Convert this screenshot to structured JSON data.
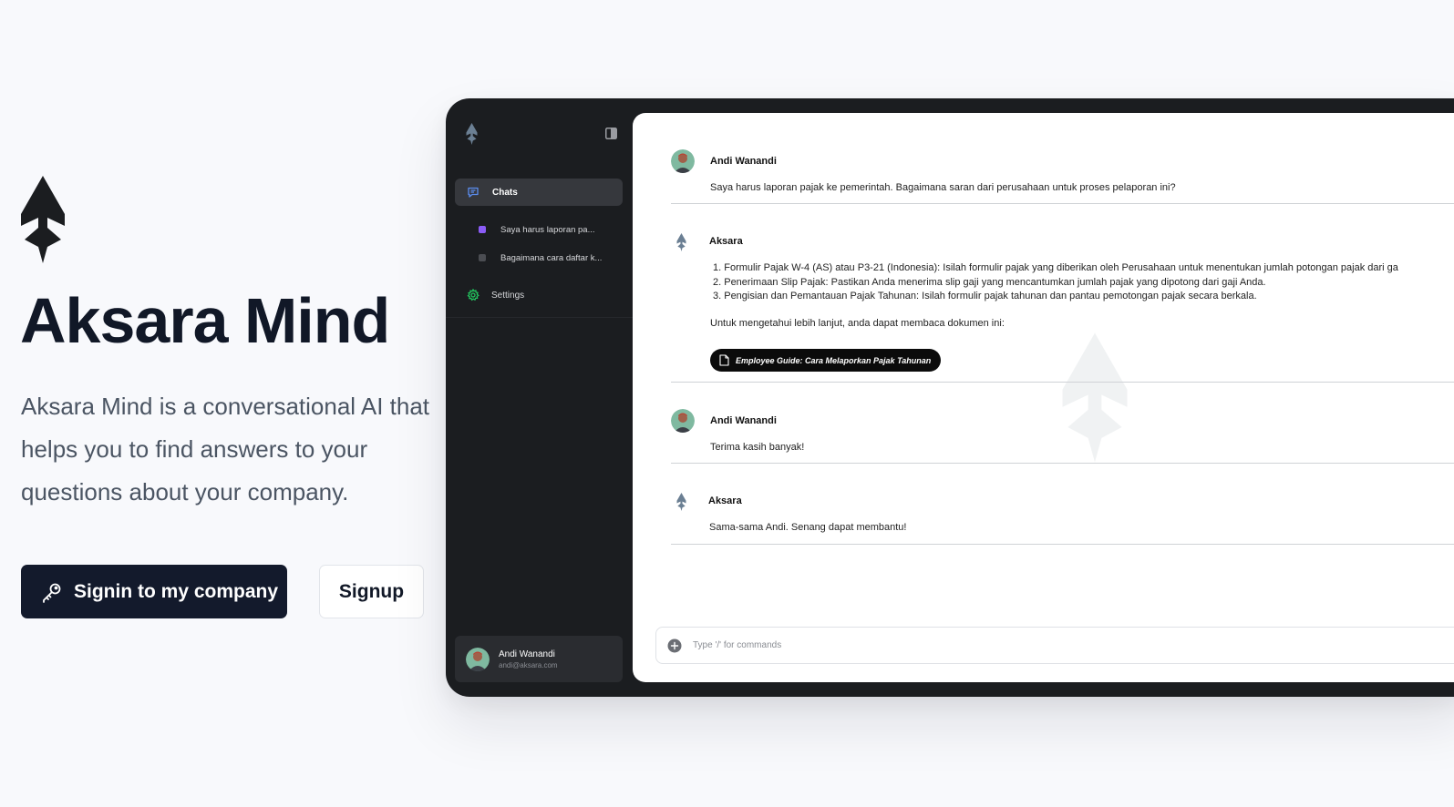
{
  "hero": {
    "title": "Aksara Mind",
    "description": "Aksara Mind is a conversational AI that helps you to find answers to your questions about your company.",
    "signin_label": "Signin to my company",
    "signup_label": "Signup"
  },
  "sidebar": {
    "chats_label": "Chats",
    "chat_items": [
      {
        "label": "Saya harus laporan pa...",
        "color": "#8b5cf6"
      },
      {
        "label": "Bagaimana cara daftar k...",
        "color": "#4b4d52"
      }
    ],
    "settings_label": "Settings",
    "settings_icon_color": "#22c55e",
    "user": {
      "name": "Andi Wanandi",
      "email": "andi@aksara.com"
    }
  },
  "chat": {
    "messages": [
      {
        "author": "Andi Wanandi",
        "text": "Saya harus laporan pajak ke pemerintah. Bagaimana saran dari perusahaan untuk proses pelaporan ini?"
      },
      {
        "author": "Aksara",
        "list": [
          "1. Formulir Pajak W-4 (AS) atau P3-21 (Indonesia): Isilah formulir pajak yang diberikan oleh Perusahaan untuk menentukan jumlah potongan pajak dari ga",
          "2. Penerimaan Slip Pajak: Pastikan Anda menerima slip gaji yang mencantumkan jumlah pajak yang dipotong dari gaji Anda.",
          "3. Pengisian dan Pemantauan Pajak Tahunan: Isilah formulir pajak tahunan dan pantau pemotongan pajak secara berkala."
        ],
        "text": "Untuk mengetahui lebih lanjut, anda dapat membaca dokumen ini:",
        "doc_label": "Employee Guide: Cara Melaporkan Pajak Tahunan"
      },
      {
        "author": "Andi Wanandi",
        "text": "Terima kasih banyak!"
      },
      {
        "author": "Aksara",
        "text": "Sama-sama Andi. Senang dapat membantu!"
      }
    ],
    "input_placeholder": "Type '/' for commands"
  },
  "colors": {
    "primary_dark": "#131a2c",
    "sidebar_bg": "#1b1d20",
    "brand_icon": "#6b7f93"
  }
}
